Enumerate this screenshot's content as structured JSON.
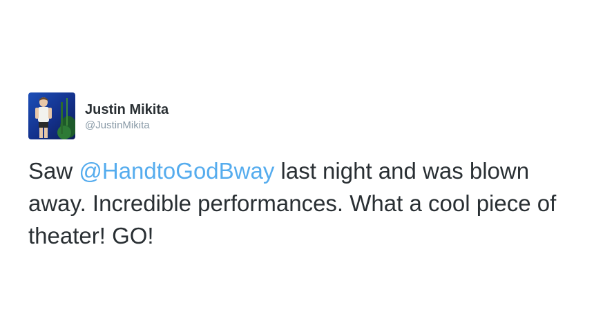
{
  "tweet": {
    "author": {
      "display_name": "Justin Mikita",
      "screen_name": "@JustinMikita",
      "avatar_icon": "profile-photo"
    },
    "text": {
      "before_mention": "Saw ",
      "mention": "@HandtoGodBway",
      "after_mention": " last night and was blown away. Incredible performances. What a cool piece of theater! GO!"
    },
    "colors": {
      "text": "#292f33",
      "mention": "#55acee",
      "screen_name": "#8899a6"
    }
  }
}
